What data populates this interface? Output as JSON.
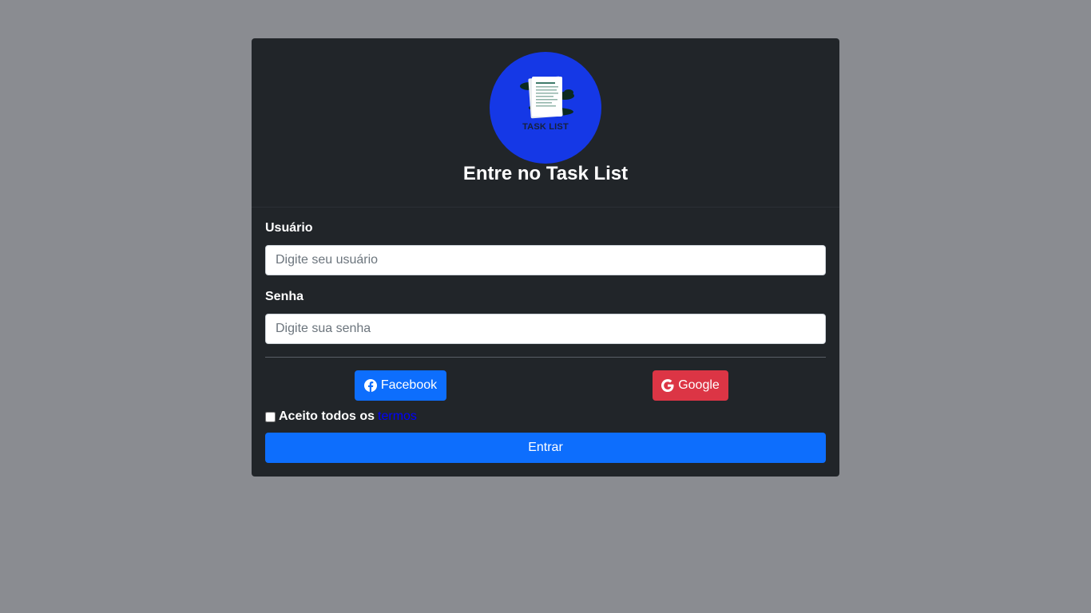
{
  "header": {
    "logo_text": "TASK LIST",
    "title": "Entre no Task List"
  },
  "form": {
    "user_label": "Usuário",
    "user_placeholder": "Digite seu usuário",
    "password_label": "Senha",
    "password_placeholder": "Digite sua senha",
    "facebook_label": "Facebook",
    "google_label": "Google",
    "terms_text": "Aceito todos os",
    "terms_link": "termos",
    "submit_label": "Entrar"
  },
  "icons": {
    "facebook": "facebook-icon",
    "google": "google-icon"
  },
  "colors": {
    "page_bg": "#8a8c91",
    "card_bg": "#212529",
    "primary": "#0d6efd",
    "danger": "#dc3545",
    "logo_bg": "#1538e6",
    "link": "#0000ff"
  }
}
